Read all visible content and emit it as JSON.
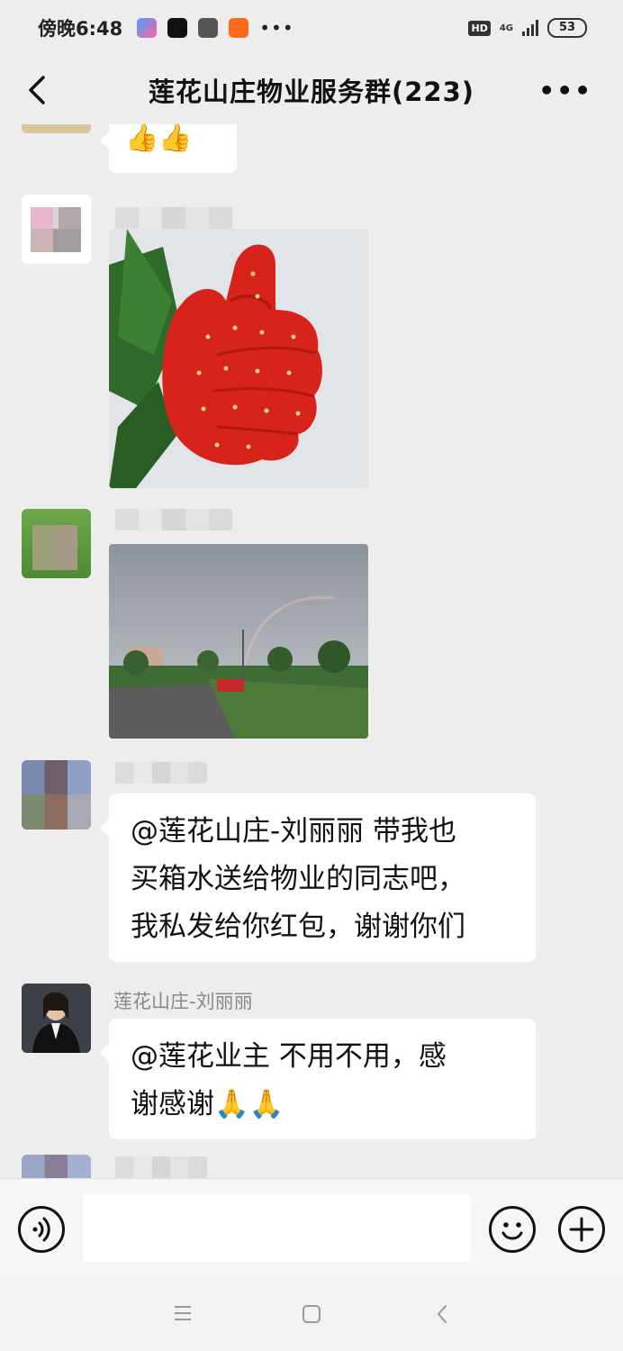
{
  "status_bar": {
    "time": "傍晚6:48",
    "more": "•••",
    "hd": "HD",
    "network": "4G",
    "battery": "53"
  },
  "nav": {
    "title": "莲花山庄物业服务群(223)",
    "more": "•••"
  },
  "messages": [
    {
      "type": "emoji",
      "content": "👍👍"
    },
    {
      "type": "image",
      "content": "strawberry-thumbs-up"
    },
    {
      "type": "image",
      "content": "rainbow-road"
    },
    {
      "type": "text",
      "lines": [
        "@莲花山庄-刘丽丽  带我也",
        "买箱水送给物业的同志吧，",
        "我私发给你红包，谢谢你们"
      ]
    },
    {
      "type": "text",
      "sender": "莲花山庄-刘丽丽",
      "lines": [
        "@莲花业主  不用不用，感",
        "谢感谢🙏🙏"
      ]
    }
  ],
  "input_bar": {
    "voice": "voice-icon",
    "emoji": "smiley-icon",
    "add": "plus-icon"
  },
  "colors": {
    "chat_bg": "#ededed",
    "bubble_bg": "#ffffff",
    "sender_gray": "#888888"
  }
}
